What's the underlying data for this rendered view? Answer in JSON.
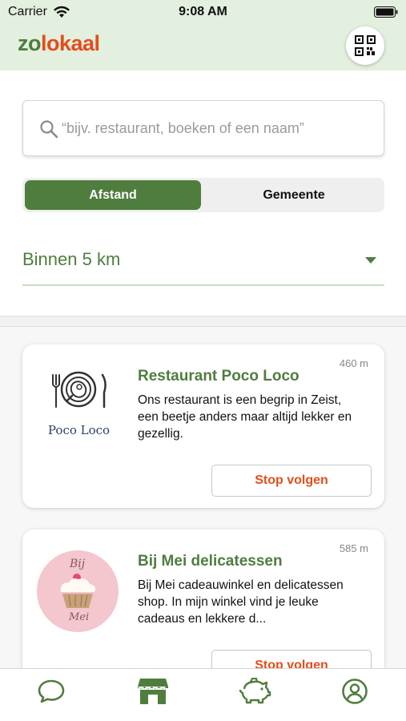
{
  "status_bar": {
    "carrier": "Carrier",
    "time": "9:08 AM",
    "icons": [
      "wifi-icon",
      "battery-icon"
    ]
  },
  "header": {
    "logo_part1": "zo",
    "logo_part2": "lokaal",
    "qr_button_icon": "qr-code-icon"
  },
  "search": {
    "placeholder": "“bijv. restaurant, boeken of een naam”",
    "value": ""
  },
  "segment": {
    "options": [
      "Afstand",
      "Gemeente"
    ],
    "selected": "Afstand"
  },
  "distance_filter": {
    "value": "Binnen 5 km"
  },
  "shops": [
    {
      "name": "Restaurant Poco Loco",
      "distance": "460 m",
      "description": "Ons restaurant is een begrip in Zeist,  een beetje  anders maar altijd lekker en gezellig.",
      "logo_text": "Poco Loco",
      "button": "Stop volgen"
    },
    {
      "name": "Bij Mei delicatessen",
      "distance": "585 m",
      "description": "Bij Mei cadeauwinkel en delicatessen shop. In mijn winkel vind je leuke cadeaus en lekkere d...",
      "logo_text_top": "Bij",
      "logo_text_bottom": "Mei",
      "button": "Stop volgen"
    }
  ],
  "tab_bar": {
    "tabs": [
      "chat-icon",
      "shop-icon",
      "piggy-bank-icon",
      "profile-icon"
    ],
    "active": "shop-icon"
  },
  "colors": {
    "brand_green": "#4f7d3e",
    "brand_orange": "#e24e1b",
    "header_bg": "#e3efdf"
  }
}
